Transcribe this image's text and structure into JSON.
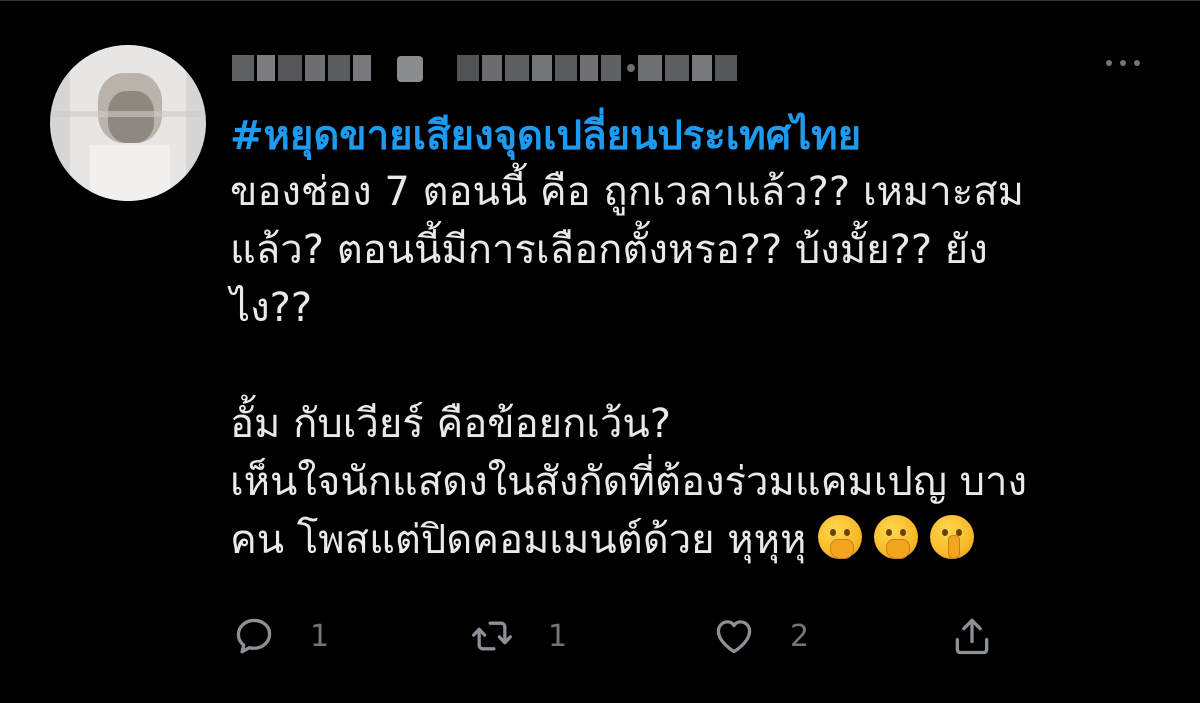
{
  "tweet": {
    "author_display_name": "",
    "author_handle": "",
    "timestamp": "30 ชม.",
    "hashtag": "#หยุดขายเสียงจุดเปลี่ยนประเทศไทย",
    "lines": [
      "ของช่อง 7 ตอนนี้ คือ ถูกเวลาแล้ว?? เหมาะสม",
      "แล้ว? ตอนนี้มีการเลือกตั้งหรอ?? บ้งมั้ย?? ยัง",
      "ไง??",
      "",
      "อั้ม กับเวียร์ คือข้อยกเว้น?",
      "เห็นใจนักแสดงในสังกัดที่ต้องร่วมแคมเปญ บาง",
      "คน โพสแต่ปิดคอมเมนต์ด้วย หุหุหุ"
    ],
    "emojis": [
      "face-with-hand-over-mouth-icon",
      "face-with-hand-over-mouth-icon",
      "shushing-face-icon"
    ]
  },
  "actions": {
    "reply_count": "1",
    "retweet_count": "1",
    "like_count": "2"
  },
  "colors": {
    "background": "#000000",
    "text": "#e7e9ea",
    "link": "#1d9bf0",
    "muted": "#71767b"
  }
}
